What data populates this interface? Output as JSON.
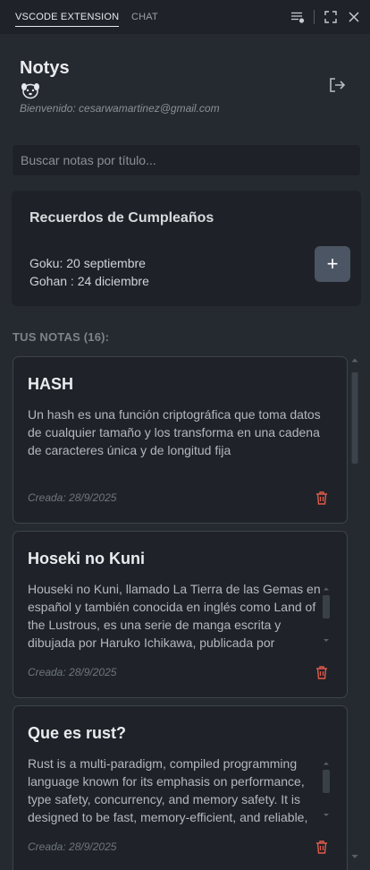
{
  "tabs": [
    {
      "label": "VSCODE EXTENSION",
      "active": true
    },
    {
      "label": "CHAT",
      "active": false
    }
  ],
  "toolbar_icons": [
    "list-filter-icon",
    "maximize-icon",
    "close-icon"
  ],
  "app": {
    "title": "Notys",
    "emoji_icon": "dog-face-icon",
    "welcome": "Bienvenido: cesarwamartinez@gmail.com",
    "logout_icon": "logout-icon"
  },
  "search": {
    "placeholder": "Buscar notas por título..."
  },
  "birthdays": {
    "title": "Recuerdos de Cumpleaños",
    "entries": [
      "Goku: 20 septiembre",
      "Gohan : 24 diciembre"
    ],
    "add_label": "+"
  },
  "notes_section": {
    "label": "TUS NOTAS (16):"
  },
  "notes": [
    {
      "title": "HASH",
      "body": "Un hash es una función criptográfica que toma datos de cualquier tamaño y los transforma en una cadena de caracteres única y de longitud fija",
      "date": "Creada: 28/9/2025"
    },
    {
      "title": "Hoseki no Kuni",
      "body": "Houseki no Kuni, llamado La Tierra de las Gemas en español y también conocida en inglés como Land of the Lustrous, es una serie de manga escrita y dibujada por Haruko Ichikawa, publicada por",
      "date": "Creada: 28/9/2025"
    },
    {
      "title": "Que es rust?",
      "body": "Rust is a multi-paradigm, compiled programming language known for its emphasis on performance, type safety, concurrency, and memory safety. It is designed to be fast, memory-efficient, and reliable,",
      "date": "Creada: 28/9/2025"
    }
  ],
  "colors": {
    "background": "#252a31",
    "card": "#1f2329",
    "delete": "#e05a4b",
    "add_button": "#4b5563"
  }
}
